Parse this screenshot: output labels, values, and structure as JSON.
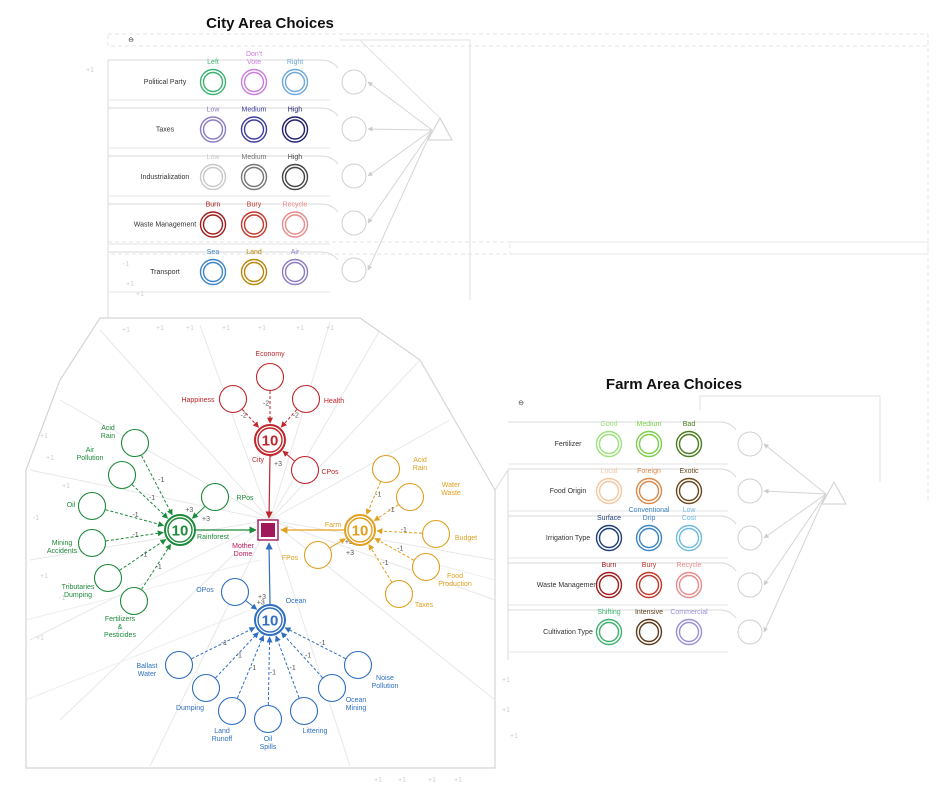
{
  "city_title": "City Area Choices",
  "farm_title": "Farm Area Choices",
  "collapse_symbol": "⊖",
  "city_rows": [
    {
      "label": "Political Party",
      "options": [
        {
          "text": "Left",
          "color": "#3cb371"
        },
        {
          "text": "Don't Vote",
          "color": "#c77dde"
        },
        {
          "text": "Right",
          "color": "#6fa8dc"
        }
      ]
    },
    {
      "label": "Taxes",
      "options": [
        {
          "text": "Low",
          "color": "#8e7cc3"
        },
        {
          "text": "Medium",
          "color": "#3d3d9e"
        },
        {
          "text": "High",
          "color": "#20206e"
        }
      ]
    },
    {
      "label": "Industrialization",
      "options": [
        {
          "text": "Low",
          "color": "#c8c8c8"
        },
        {
          "text": "Medium",
          "color": "#777777"
        },
        {
          "text": "High",
          "color": "#444444"
        }
      ]
    },
    {
      "label": "Waste Management",
      "options": [
        {
          "text": "Burn",
          "color": "#a01c1c"
        },
        {
          "text": "Bury",
          "color": "#c0392b"
        },
        {
          "text": "Recycle",
          "color": "#e88b8b"
        }
      ]
    },
    {
      "label": "Transport",
      "options": [
        {
          "text": "Sea",
          "color": "#3d85c6"
        },
        {
          "text": "Land",
          "color": "#b8860b"
        },
        {
          "text": "Air",
          "color": "#8e7cc3"
        }
      ]
    }
  ],
  "farm_rows": [
    {
      "label": "Fertilizer",
      "options": [
        {
          "text": "Good",
          "color": "#9be37a"
        },
        {
          "text": "Medium",
          "color": "#7ccf4c"
        },
        {
          "text": "Bad",
          "color": "#4a7d1e"
        }
      ]
    },
    {
      "label": "Food Origin",
      "options": [
        {
          "text": "Local",
          "color": "#f4c7a0"
        },
        {
          "text": "Foreign",
          "color": "#d9894a"
        },
        {
          "text": "Exotic",
          "color": "#6b4a1e"
        }
      ]
    },
    {
      "label": "Irrigation Type",
      "options": [
        {
          "text": "Surface",
          "color": "#1f3f7a"
        },
        {
          "text": "Conventional Drip",
          "color": "#3d85c6"
        },
        {
          "text": "Low Cost",
          "color": "#6fbbe0"
        }
      ]
    },
    {
      "label": "Waste Management",
      "options": [
        {
          "text": "Burn",
          "color": "#a01c1c"
        },
        {
          "text": "Bury",
          "color": "#c0392b"
        },
        {
          "text": "Recycle",
          "color": "#e88b8b"
        }
      ]
    },
    {
      "label": "Cultivation Type",
      "options": [
        {
          "text": "Shifting",
          "color": "#3cb371"
        },
        {
          "text": "Intensive",
          "color": "#5c3a1a"
        },
        {
          "text": "Commercial",
          "color": "#9b8fd8"
        }
      ]
    }
  ],
  "center": {
    "label": "Mother Dome",
    "color": "#a0185a"
  },
  "hubs": {
    "city": {
      "name": "City",
      "value": "10",
      "color": "#c0262c"
    },
    "rainforest": {
      "name": "Rainforest",
      "value": "10",
      "color": "#1e8a3c"
    },
    "farm": {
      "name": "Farm",
      "value": "10",
      "color": "#e0a020"
    },
    "ocean": {
      "name": "Ocean",
      "value": "10",
      "color": "#2f6fbf"
    }
  },
  "city_factors": [
    {
      "name": "Economy",
      "weight": "-2"
    },
    {
      "name": "Happiness",
      "weight": "-2"
    },
    {
      "name": "Health",
      "weight": "-2"
    },
    {
      "name": "CPos",
      "weight": "+3"
    }
  ],
  "rainforest_factors": [
    {
      "name": "Acid Rain",
      "weight": "-1"
    },
    {
      "name": "Air Pollution",
      "weight": "-1"
    },
    {
      "name": "Oil",
      "weight": "-1"
    },
    {
      "name": "Mining Accidents",
      "weight": "-1"
    },
    {
      "name": "Tributaries Dumping",
      "weight": "-1"
    },
    {
      "name": "Fertilizers & Pesticides",
      "weight": "-1"
    },
    {
      "name": "RPos",
      "weight": "+3"
    }
  ],
  "farm_factors": [
    {
      "name": "Acid Rain",
      "weight": "-1"
    },
    {
      "name": "Water Waste",
      "weight": "-1"
    },
    {
      "name": "Budget",
      "weight": "-1"
    },
    {
      "name": "Food Production",
      "weight": "-1"
    },
    {
      "name": "Taxes",
      "weight": "-1"
    },
    {
      "name": "FPos",
      "weight": "+3"
    }
  ],
  "ocean_factors": [
    {
      "name": "OPos",
      "weight": "+3"
    },
    {
      "name": "Ballast Water",
      "weight": "-1"
    },
    {
      "name": "Dumping",
      "weight": "-1"
    },
    {
      "name": "Land Runoff",
      "weight": "-1"
    },
    {
      "name": "Oil Spills",
      "weight": "-1"
    },
    {
      "name": "Littering",
      "weight": "-1"
    },
    {
      "name": "Ocean Mining",
      "weight": "-1"
    },
    {
      "name": "Noise Pollution",
      "weight": "-1"
    }
  ],
  "hub_weights": {
    "city": "+3",
    "rainforest": "+3",
    "farm": "+3",
    "ocean": "+3"
  },
  "faint_marks": [
    "+1",
    "+1",
    "+1",
    "-1",
    "+1",
    "+1",
    "-1",
    "+1",
    "+1",
    "-1",
    "+1",
    "+1",
    "+1",
    "+1",
    "+1",
    "+1",
    "+1",
    "+1",
    "+1",
    "+1",
    "+1",
    "+1",
    "+1",
    "+1",
    "+1"
  ]
}
